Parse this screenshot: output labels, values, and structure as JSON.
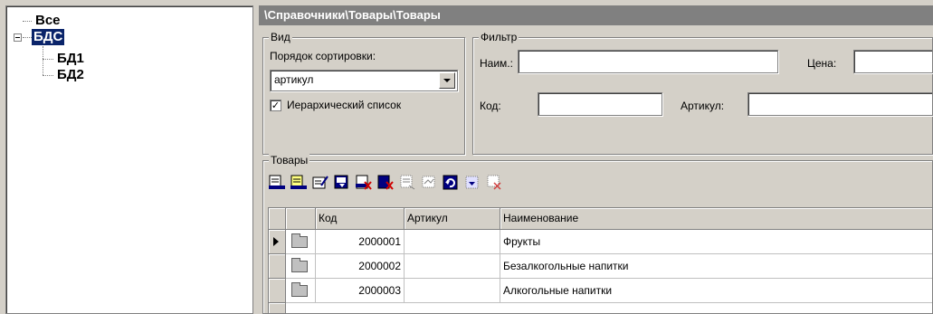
{
  "tree": {
    "items": [
      {
        "label": "Все",
        "selected": false
      },
      {
        "label": "БДС",
        "selected": true
      },
      {
        "label": "БД1",
        "selected": false
      },
      {
        "label": "БД2",
        "selected": false
      }
    ]
  },
  "header": {
    "title": "\\Справочники\\Товары\\Товары"
  },
  "view_group": {
    "label": "Вид",
    "sort_label": "Порядок сортировки:",
    "sort_value": "артикул",
    "hierarchical_label": "Иерархический список",
    "hierarchical_checked": true
  },
  "filter_group": {
    "label": "Фильтр",
    "name_label": "Наим.:",
    "name_value": "",
    "price_label": "Цена:",
    "price_value": "",
    "code_label": "Код:",
    "code_value": "",
    "article_label": "Артикул:",
    "article_value": ""
  },
  "goods_group": {
    "label": "Товары",
    "toolbar_icons": [
      "add-item-icon",
      "add-group-icon",
      "edit-icon",
      "copy-icon",
      "delete-icon",
      "delete-group-icon",
      "move-icon",
      "move-group-icon",
      "refresh-icon",
      "select-icon",
      "clear-filter-icon"
    ]
  },
  "table": {
    "columns": [
      "Код",
      "Артикул",
      "Наименование"
    ],
    "rows": [
      {
        "code": "2000001",
        "article": "",
        "name": "Фрукты",
        "current": true
      },
      {
        "code": "2000002",
        "article": "",
        "name": "Безалкогольные напитки",
        "current": false
      },
      {
        "code": "2000003",
        "article": "",
        "name": "Алкогольные напитки",
        "current": false
      }
    ]
  },
  "colors": {
    "selection": "#0a246a",
    "panel": "#d4d0c8",
    "titlebar": "#808080"
  }
}
